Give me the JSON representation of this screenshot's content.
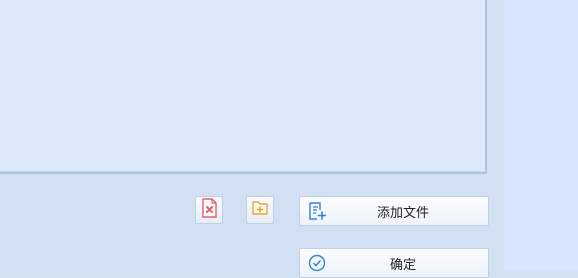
{
  "buttons": {
    "add_files_label": "添加文件",
    "confirm_label": "确定"
  },
  "icons": {
    "delete": "delete-file-icon",
    "new_folder": "new-folder-icon",
    "add_files": "add-file-icon",
    "confirm": "check-circle-icon"
  },
  "colors": {
    "delete_accent": "#e35d6a",
    "folder_accent": "#e5a93a",
    "button_icon_blue": "#3a7fd0"
  }
}
